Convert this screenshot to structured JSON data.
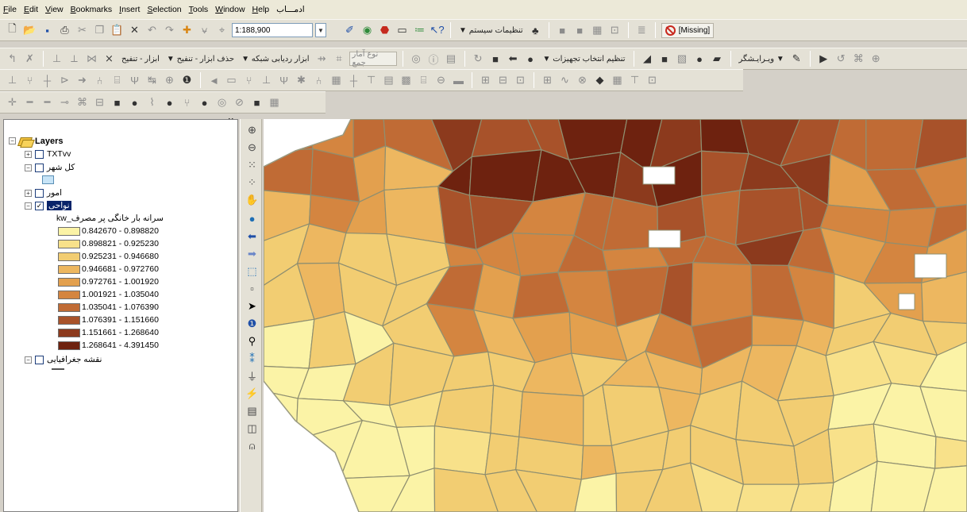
{
  "menu": [
    "File",
    "Edit",
    "View",
    "Bookmarks",
    "Insert",
    "Selection",
    "Tools",
    "Window",
    "Help",
    "ادمـــاب"
  ],
  "toolbar1": {
    "scale": "1:188,900",
    "system_settings": "تنظیمات سیستم",
    "missing_label": "[Missing]"
  },
  "toolbar2": {
    "attribute_tools": "ابزار - تنفیح",
    "delete_tools": "حذف ابزار - تنفیح",
    "network_tools": "ابزار ردیابی شبکه",
    "update_label": "نوع آمار جمع",
    "equipment_selection": "تنظیم انتخاب تجهیزات",
    "editor_label": "ویـرایـشگر"
  },
  "toc": {
    "root": "Layers",
    "layers": [
      {
        "label": "TXTvv",
        "checked": false
      },
      {
        "label": "کل شهر",
        "checked": false
      },
      {
        "label": "امور",
        "checked": false
      },
      {
        "label": "نواحی",
        "checked": true
      }
    ],
    "field_label": "kw_سرانه بار خانگی پر مصرف",
    "legend": [
      {
        "range": "0.842670 - 0.898820",
        "color": "#fbf3a6"
      },
      {
        "range": "0.898821 - 0.925230",
        "color": "#f8e18a"
      },
      {
        "range": "0.925231 - 0.946680",
        "color": "#f2cd72"
      },
      {
        "range": "0.946681 - 0.972760",
        "color": "#edb760"
      },
      {
        "range": "0.972761 - 1.001920",
        "color": "#e3a04e"
      },
      {
        "range": "1.001921 - 1.035040",
        "color": "#d48540"
      },
      {
        "range": "1.035041 - 1.076390",
        "color": "#c06b35"
      },
      {
        "range": "1.076391 - 1.151660",
        "color": "#a8522a"
      },
      {
        "range": "1.151661 - 1.268640",
        "color": "#8c3a1d"
      },
      {
        "range": "1.268641 - 4.391450",
        "color": "#6e220f"
      }
    ],
    "base_map": "نقشه جغرافیایی"
  },
  "icons": {
    "vertical_tools": [
      "zoom-in-icon",
      "zoom-out-icon",
      "fixed-zoom-in-icon",
      "fixed-zoom-out-icon",
      "pan-icon",
      "full-extent-icon",
      "back-icon",
      "forward-icon",
      "select-features-icon",
      "clear-selection-icon",
      "select-elements-icon",
      "identify-icon",
      "find-icon",
      "go-to-xy-icon",
      "measure-icon",
      "hyperlink-icon",
      "html-popup-icon",
      "time-slider-icon",
      "swipe-icon"
    ]
  }
}
